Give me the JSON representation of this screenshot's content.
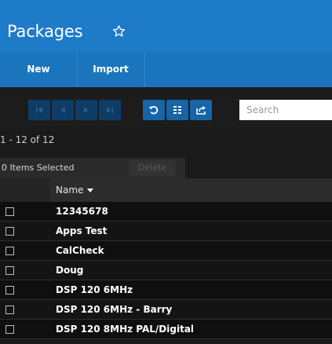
{
  "header": {
    "title": "Packages",
    "favorite_icon": "star-outline-icon",
    "color": "#1e7bc8"
  },
  "actions": {
    "new_label": "New",
    "import_label": "Import"
  },
  "toolbar": {
    "buttons": [
      {
        "icon": "first-page-icon",
        "enabled": false
      },
      {
        "icon": "previous-page-icon",
        "enabled": false
      },
      {
        "icon": "next-page-icon",
        "enabled": false
      },
      {
        "icon": "last-page-icon",
        "enabled": false
      },
      {
        "icon": "refresh-icon",
        "enabled": true
      },
      {
        "icon": "columns-icon",
        "enabled": true
      },
      {
        "icon": "export-icon",
        "enabled": true
      }
    ],
    "search_placeholder": "Search"
  },
  "status": {
    "record_count": "1 - 12 of 12",
    "items_selected": "0 Items Selected",
    "delete_label": "Delete"
  },
  "table": {
    "columns": [
      {
        "label": "Name",
        "sort": "descending"
      }
    ],
    "rows": [
      {
        "name": "12345678"
      },
      {
        "name": "Apps Test"
      },
      {
        "name": "CalCheck"
      },
      {
        "name": "Doug"
      },
      {
        "name": "DSP 120 6MHz"
      },
      {
        "name": "DSP 120 6MHz - Barry"
      },
      {
        "name": "DSP 120 8MHz PAL/Digital"
      }
    ]
  }
}
